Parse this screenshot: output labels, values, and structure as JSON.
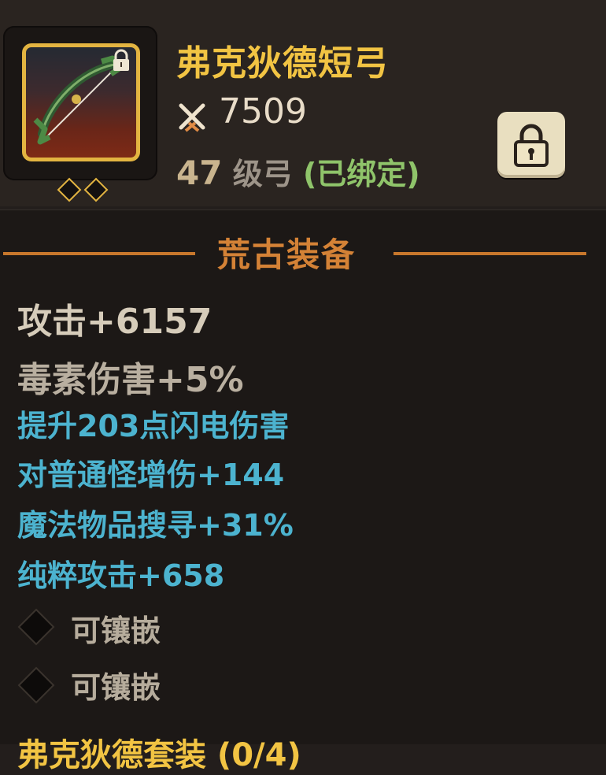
{
  "item": {
    "name": "弗克狄德短弓",
    "power": "7509",
    "level": "47",
    "type": "级弓",
    "bound": "(已绑定)",
    "icon": "bow-icon",
    "gem_slots": 2
  },
  "icons": {
    "power": "crossed-swords-icon",
    "lock": "lock-icon",
    "socket": "diamond-socket-icon"
  },
  "section": {
    "title": "荒古装备"
  },
  "stats": {
    "main": [
      "攻击+6157",
      "毒素伤害+5%"
    ],
    "bonus": [
      "提升203点闪电伤害",
      "对普通怪增伤+144",
      "魔法物品搜寻+31%",
      "纯粹攻击+658"
    ]
  },
  "sockets": [
    {
      "label": "可镶嵌"
    },
    {
      "label": "可镶嵌"
    }
  ],
  "set": {
    "label": "弗克狄德套装 (0/4)"
  },
  "colors": {
    "name": "#f2c443",
    "section": "#d48236",
    "bonus_stat": "#4cb3cf",
    "bound": "#8fc46a"
  }
}
